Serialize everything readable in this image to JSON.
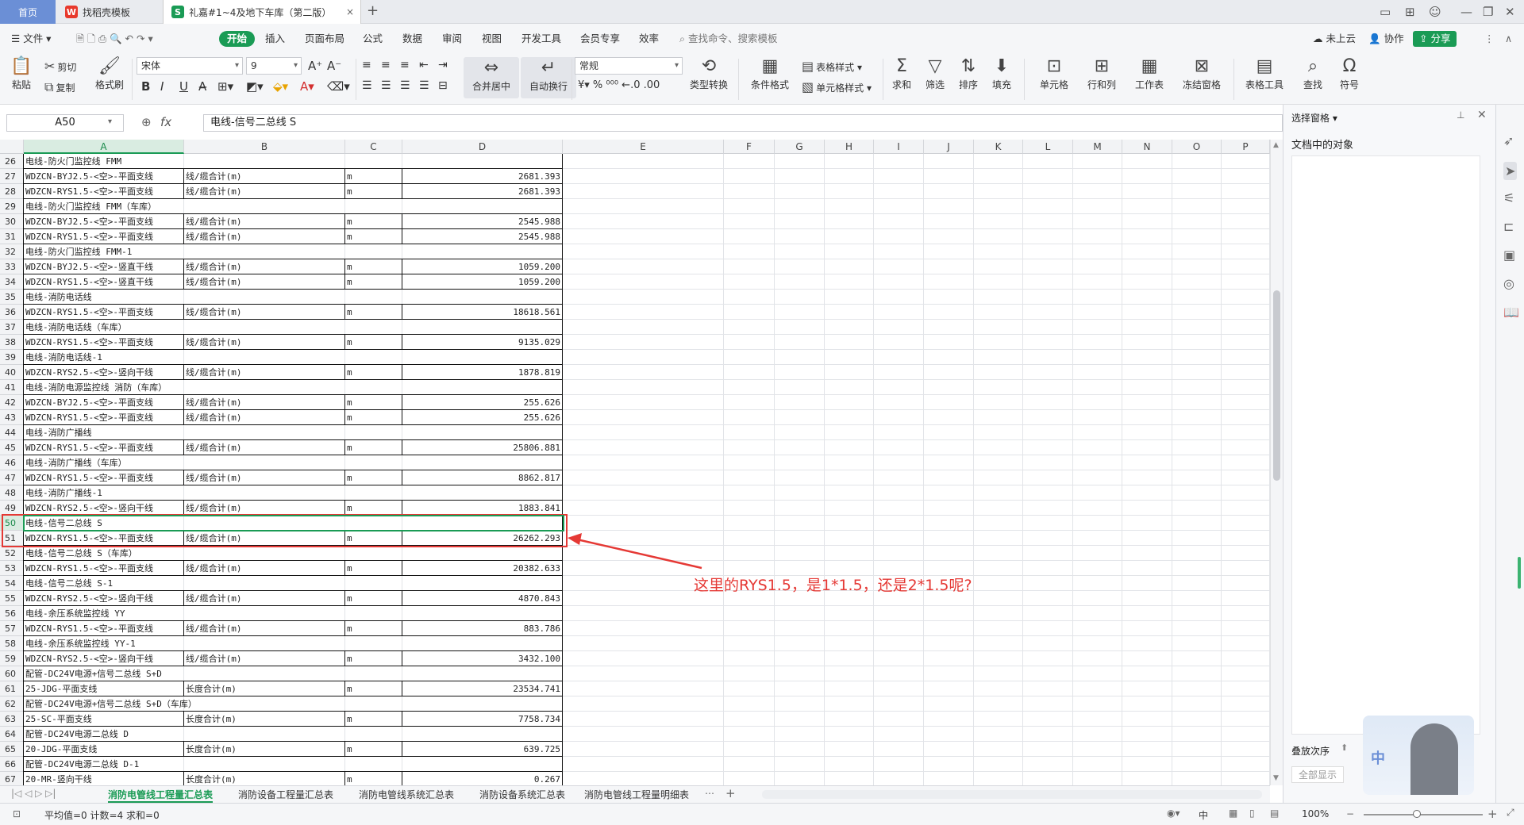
{
  "titlebar": {
    "tabs": [
      {
        "label": "首页",
        "icon": "home"
      },
      {
        "label": "找稻壳模板",
        "icon": "docer-icon"
      },
      {
        "label": "礼嘉#1~4及地下车库（第二版）",
        "icon": "spreadsheet-icon"
      }
    ]
  },
  "menubar": {
    "file": "文件",
    "items": [
      "开始",
      "插入",
      "页面布局",
      "公式",
      "数据",
      "审阅",
      "视图",
      "开发工具",
      "会员专享",
      "效率"
    ],
    "search_placeholder": "查找命令、搜索模板",
    "cloud": "未上云",
    "collab": "协作",
    "share": "分享"
  },
  "ribbon": {
    "paste": "粘贴",
    "cut": "剪切",
    "copy": "复制",
    "format_painter": "格式刷",
    "font_name": "宋体",
    "font_size": "9",
    "merge": "合并居中",
    "wrap": "自动换行",
    "number_format": "常规",
    "type_convert": "类型转换",
    "cond_format": "条件格式",
    "table_style": "表格样式",
    "cell_style": "单元格样式",
    "sum": "求和",
    "filter": "筛选",
    "sort": "排序",
    "fill": "填充",
    "cell": "单元格",
    "rowcol": "行和列",
    "worksheet": "工作表",
    "freeze": "冻结窗格",
    "table_tools": "表格工具",
    "find": "查找",
    "symbol": "符号"
  },
  "formula": {
    "name_box": "A50",
    "fx": "fx",
    "content": "电线-信号二总线 S"
  },
  "columns": [
    "A",
    "B",
    "C",
    "D",
    "E",
    "F",
    "G",
    "H",
    "I",
    "J",
    "K",
    "L",
    "M",
    "N",
    "O",
    "P"
  ],
  "rows": [
    {
      "n": "26",
      "a": "电线-防火门监控线 FMM",
      "b": "",
      "c": "",
      "d": ""
    },
    {
      "n": "27",
      "a": "WDZCN-BYJ2.5-<空>-平面支线",
      "b": "线/缆合计(m)",
      "c": "m",
      "d": "2681.393"
    },
    {
      "n": "28",
      "a": "WDZCN-RYS1.5-<空>-平面支线",
      "b": "线/缆合计(m)",
      "c": "m",
      "d": "2681.393"
    },
    {
      "n": "29",
      "a": "电线-防火门监控线 FMM（车库）",
      "b": "",
      "c": "",
      "d": ""
    },
    {
      "n": "30",
      "a": "WDZCN-BYJ2.5-<空>-平面支线",
      "b": "线/缆合计(m)",
      "c": "m",
      "d": "2545.988"
    },
    {
      "n": "31",
      "a": "WDZCN-RYS1.5-<空>-平面支线",
      "b": "线/缆合计(m)",
      "c": "m",
      "d": "2545.988"
    },
    {
      "n": "32",
      "a": "电线-防火门监控线 FMM-1",
      "b": "",
      "c": "",
      "d": ""
    },
    {
      "n": "33",
      "a": "WDZCN-BYJ2.5-<空>-竖直干线",
      "b": "线/缆合计(m)",
      "c": "m",
      "d": "1059.200"
    },
    {
      "n": "34",
      "a": "WDZCN-RYS1.5-<空>-竖直干线",
      "b": "线/缆合计(m)",
      "c": "m",
      "d": "1059.200"
    },
    {
      "n": "35",
      "a": "电线-消防电话线",
      "b": "",
      "c": "",
      "d": ""
    },
    {
      "n": "36",
      "a": "WDZCN-RYS1.5-<空>-平面支线",
      "b": "线/缆合计(m)",
      "c": "m",
      "d": "18618.561"
    },
    {
      "n": "37",
      "a": "电线-消防电话线（车库）",
      "b": "",
      "c": "",
      "d": ""
    },
    {
      "n": "38",
      "a": "WDZCN-RYS1.5-<空>-平面支线",
      "b": "线/缆合计(m)",
      "c": "m",
      "d": "9135.029"
    },
    {
      "n": "39",
      "a": "电线-消防电话线-1",
      "b": "",
      "c": "",
      "d": ""
    },
    {
      "n": "40",
      "a": "WDZCN-RYS2.5-<空>-竖向干线",
      "b": "线/缆合计(m)",
      "c": "m",
      "d": "1878.819"
    },
    {
      "n": "41",
      "a": "电线-消防电源监控线 消防（车库）",
      "b": "",
      "c": "",
      "d": ""
    },
    {
      "n": "42",
      "a": "WDZCN-BYJ2.5-<空>-平面支线",
      "b": "线/缆合计(m)",
      "c": "m",
      "d": "255.626"
    },
    {
      "n": "43",
      "a": "WDZCN-RYS1.5-<空>-平面支线",
      "b": "线/缆合计(m)",
      "c": "m",
      "d": "255.626"
    },
    {
      "n": "44",
      "a": "电线-消防广播线",
      "b": "",
      "c": "",
      "d": ""
    },
    {
      "n": "45",
      "a": "WDZCN-RYS1.5-<空>-平面支线",
      "b": "线/缆合计(m)",
      "c": "m",
      "d": "25806.881"
    },
    {
      "n": "46",
      "a": "电线-消防广播线（车库）",
      "b": "",
      "c": "",
      "d": ""
    },
    {
      "n": "47",
      "a": "WDZCN-RYS1.5-<空>-平面支线",
      "b": "线/缆合计(m)",
      "c": "m",
      "d": "8862.817"
    },
    {
      "n": "48",
      "a": "电线-消防广播线-1",
      "b": "",
      "c": "",
      "d": ""
    },
    {
      "n": "49",
      "a": "WDZCN-RYS2.5-<空>-竖向干线",
      "b": "线/缆合计(m)",
      "c": "m",
      "d": "1883.841"
    },
    {
      "n": "50",
      "a": "电线-信号二总线 S",
      "b": "",
      "c": "",
      "d": ""
    },
    {
      "n": "51",
      "a": "WDZCN-RYS1.5-<空>-平面支线",
      "b": "线/缆合计(m)",
      "c": "m",
      "d": "26262.293"
    },
    {
      "n": "52",
      "a": "电线-信号二总线 S（车库）",
      "b": "",
      "c": "",
      "d": ""
    },
    {
      "n": "53",
      "a": "WDZCN-RYS1.5-<空>-平面支线",
      "b": "线/缆合计(m)",
      "c": "m",
      "d": "20382.633"
    },
    {
      "n": "54",
      "a": "电线-信号二总线 S-1",
      "b": "",
      "c": "",
      "d": ""
    },
    {
      "n": "55",
      "a": "WDZCN-RYS2.5-<空>-竖向干线",
      "b": "线/缆合计(m)",
      "c": "m",
      "d": "4870.843"
    },
    {
      "n": "56",
      "a": "电线-余压系统监控线 YY",
      "b": "",
      "c": "",
      "d": ""
    },
    {
      "n": "57",
      "a": "WDZCN-RYS1.5-<空>-平面支线",
      "b": "线/缆合计(m)",
      "c": "m",
      "d": "883.786"
    },
    {
      "n": "58",
      "a": "电线-余压系统监控线 YY-1",
      "b": "",
      "c": "",
      "d": ""
    },
    {
      "n": "59",
      "a": "WDZCN-RYS2.5-<空>-竖向干线",
      "b": "线/缆合计(m)",
      "c": "m",
      "d": "3432.100"
    },
    {
      "n": "60",
      "a": "配管-DC24V电源+信号二总线 S+D",
      "b": "",
      "c": "",
      "d": ""
    },
    {
      "n": "61",
      "a": "25-JDG-平面支线",
      "b": "长度合计(m)",
      "c": "m",
      "d": "23534.741"
    },
    {
      "n": "62",
      "a": "配管-DC24V电源+信号二总线 S+D（车库）",
      "b": "",
      "c": "",
      "d": ""
    },
    {
      "n": "63",
      "a": "25-SC-平面支线",
      "b": "长度合计(m)",
      "c": "m",
      "d": "7758.734"
    },
    {
      "n": "64",
      "a": "配管-DC24V电源二总线 D",
      "b": "",
      "c": "",
      "d": ""
    },
    {
      "n": "65",
      "a": "20-JDG-平面支线",
      "b": "长度合计(m)",
      "c": "m",
      "d": "639.725"
    },
    {
      "n": "66",
      "a": "配管-DC24V电源二总线 D-1",
      "b": "",
      "c": "",
      "d": ""
    },
    {
      "n": "67",
      "a": "20-MR-竖向干线",
      "b": "长度合计(m)",
      "c": "m",
      "d": "0.267"
    }
  ],
  "annotation": {
    "text": "这里的RYS1.5，是1*1.5，还是2*1.5呢?"
  },
  "sheet_tabs": [
    "消防电管线工程量汇总表",
    "消防设备工程量汇总表",
    "消防电管线系统汇总表",
    "消防设备系统汇总表",
    "消防电管线工程量明细表"
  ],
  "status": {
    "stats": "平均值=0  计数=4  求和=0",
    "zoom": "100%",
    "ime": "中"
  },
  "right_pane": {
    "title": "选择窗格",
    "subtitle": "文档中的对象",
    "order": "叠放次序",
    "show_all": "全部显示",
    "ime_badge": "中"
  },
  "colors": {
    "accent": "#1a9b55",
    "annotation": "#e53935",
    "home_tab": "#6b8fd6"
  }
}
